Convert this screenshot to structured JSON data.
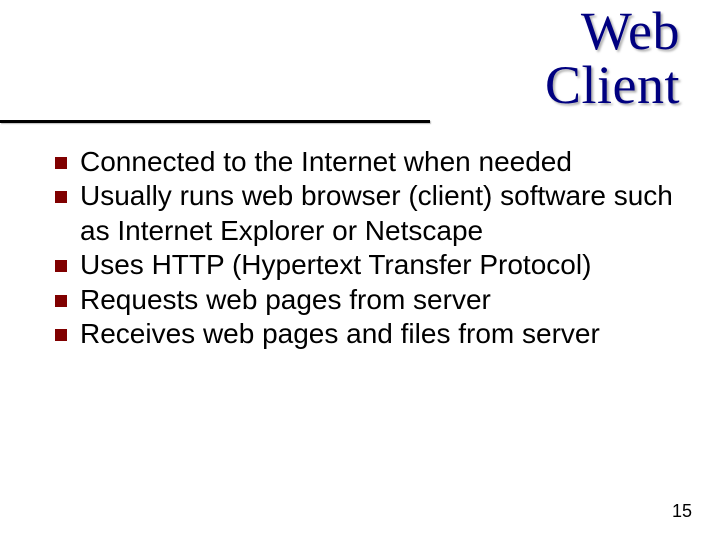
{
  "title": {
    "line1": "Web",
    "line2": "Client"
  },
  "bullets": [
    "Connected to the Internet when needed",
    "Usually runs web browser (client) software such as Internet Explorer or Netscape",
    "Uses HTTP (Hypertext Transfer Protocol)",
    "Requests web pages from server",
    "Receives web pages and files from server"
  ],
  "page_number": "15",
  "colors": {
    "title": "#000080",
    "bullet_square": "#800000"
  }
}
